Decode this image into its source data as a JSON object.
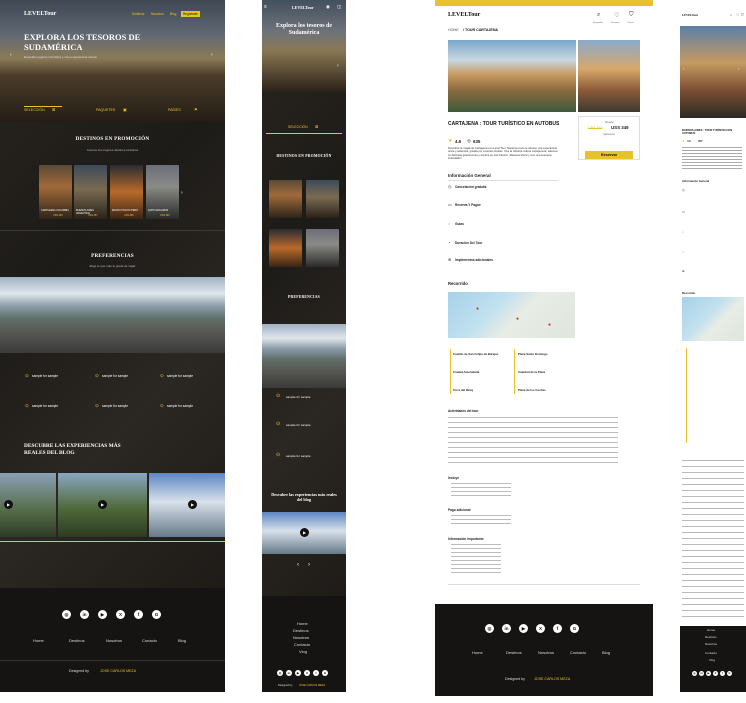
{
  "brand": {
    "logo_text": "LEVELTour",
    "accent": "#e8c22a",
    "dark_bg": "#1c1a17"
  },
  "desktop": {
    "nav": {
      "items": [
        "Destinos",
        "Nosotros",
        "Blog"
      ],
      "cta": "Regístrate"
    },
    "hero": {
      "title": "EXPLORA LOS TESOROS DE SUDAMÉRICA",
      "subtitle": "Descubre lugares increíbles y vive experiencias únicas",
      "tabs": [
        "SELECCIÓN",
        "PAQUETES",
        "PAÍSES"
      ]
    },
    "promos": {
      "heading": "DESTINOS EN PROMOCIÓN",
      "sub": "Conoce los mejores destinos turísticos",
      "cards": [
        {
          "name": "CARTAGENA COLOMBIA",
          "price": "USS 349"
        },
        {
          "name": "BUENOS AIRES ARGENTINA",
          "price": "USS 457"
        },
        {
          "name": "MACHU PICCHU PERÚ",
          "price": "USS 399"
        },
        {
          "name": "QUITO ECUADOR",
          "price": "USS 299"
        }
      ]
    },
    "prefs": {
      "heading": "PREFERENCIAS",
      "sub": "Elige lo que más te gusta de viajar"
    },
    "features": [
      {
        "title": "sample for sample"
      },
      {
        "title": "sample for sample"
      },
      {
        "title": "sample for sample"
      },
      {
        "title": "sample for sample"
      },
      {
        "title": "sample for sample"
      },
      {
        "title": "sample for sample"
      }
    ],
    "blog": {
      "heading": "DESCUBRE LAS EXPERIENCIAS MÁS REALES DEL BLOG"
    },
    "footer": {
      "social_icons": [
        "instagram-icon",
        "linkedin-icon",
        "youtube-icon",
        "x-icon",
        "facebook-icon",
        "google-icon"
      ],
      "social_glyphs": [
        "◎",
        "in",
        "▶",
        "X",
        "f",
        "G"
      ],
      "links": [
        "Home",
        "Destinos",
        "Nosotros",
        "Conacto",
        "Blog"
      ],
      "credit_prefix": "Designed by",
      "credit_name": "JOSE CARLOS MEZA"
    }
  },
  "mobile": {
    "hero_title": "Explora los tesoros de Sudamérica",
    "tab": "SELECCIÓN",
    "promos_heading": "DESTINOS EN PROMOCIÓN",
    "prefs_heading": "PREFERENCIAS",
    "feature_title": "sample for sample",
    "blog_heading": "Descubre las experiencias más reales del blog",
    "footer_links": [
      "Home",
      "Destinos",
      "Nosotros",
      "Contacto",
      "Vlog"
    ],
    "credit_prefix": "Designed by",
    "credit_name": "JOSE CARLOS MEZA"
  },
  "detail": {
    "breadcrumb_home": "HOME",
    "breadcrumb_current": "/ TOUR CARTAJENA",
    "header_icons": [
      "Busqueda",
      "Favoritos",
      "Carrito"
    ],
    "title": "CARTAJENA : TOUR TURÍSTICO EN AUTOBUS",
    "rating": "4.6",
    "reviews": "635",
    "description": "Descubre la magia de Cartagena con Level Tour. Nuestros tours te ofrecen una experiencia única y auténtica, guiada por expertos locales. Vive la vibrante cultura cartagenera, saborea su deliciosa gastronomía y explora su rica historia. ¡Reserva ahora y vive una aventura inolvidable!",
    "price_label": "Desde",
    "old_price": "USS 449",
    "price": "USS 349",
    "price_unit": "/persona",
    "reserve": "Reservar",
    "info_heading": "Información General",
    "info_items": [
      "Cancelación gratuita",
      "Reserva Y Pague",
      "Guías",
      "Duración Del Tour",
      "Implementos adicionales"
    ],
    "route_heading": "Recorrido",
    "stops": [
      "Castillo de San Felipe de Barajas",
      "Plaza Santo Domingo",
      "Ciudad Amurallada",
      "Catedral de la Plaza",
      "Torre del Reloj",
      "Plaza de los Coches"
    ],
    "activities_heading": "Actividades del tour",
    "includes_heading": "Incluye",
    "excludes_heading": "Pago adicional",
    "extra_heading": "Información importante",
    "footer_links": [
      "Home",
      "Destinos",
      "Nosotros",
      "Contacto",
      "Blog"
    ],
    "credit_prefix": "Designed by",
    "credit_name": "JOSE CARLOS MEZA"
  },
  "detail_mobile": {
    "title": "BUENOS AIRES : TOUR TURÍSTICO EN AUTOBUS",
    "rating": "4.6",
    "reviews": "457",
    "info_heading": "Información General",
    "route_heading": "Recorrido",
    "footer_links": [
      "Home",
      "Destinos",
      "Nosotros",
      "Contacto",
      "Vlog"
    ]
  }
}
